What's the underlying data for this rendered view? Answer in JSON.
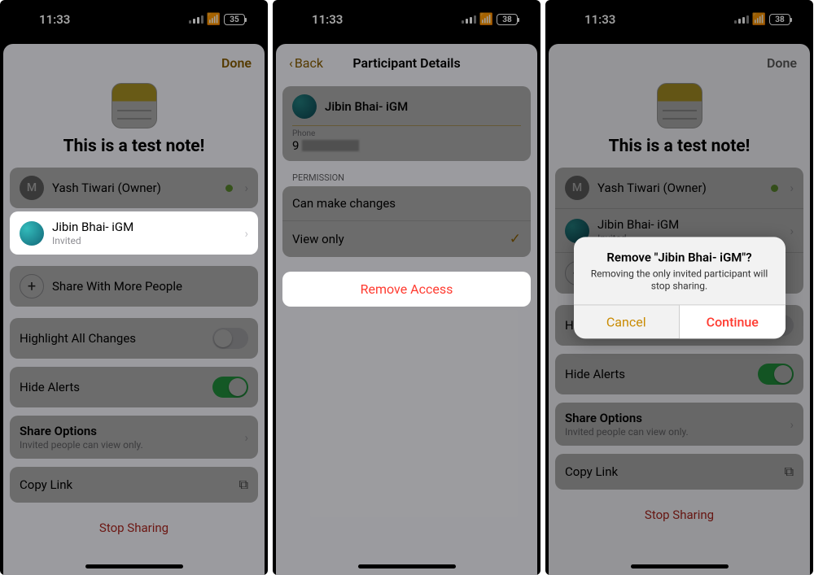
{
  "status": {
    "time": "11:33",
    "battery": "35",
    "battery2": "38"
  },
  "screen1": {
    "done": "Done",
    "note_title": "This is a test note!",
    "owner": {
      "initial": "M",
      "name": "Yash Tiwari (Owner)"
    },
    "invitee": {
      "name": "Jibin Bhai- iGM",
      "status": "Invited"
    },
    "share_more": "Share With More People",
    "highlight_all": "Highlight All Changes",
    "hide_alerts": "Hide Alerts",
    "share_options": "Share Options",
    "share_options_sub": "Invited people can view only.",
    "copy_link": "Copy Link",
    "stop_sharing": "Stop Sharing"
  },
  "screen2": {
    "back": "Back",
    "title": "Participant Details",
    "name": "Jibin Bhai- iGM",
    "phone_label": "Phone",
    "phone_prefix": "9",
    "permission": "PERMISSION",
    "can_make_changes": "Can make changes",
    "view_only": "View only",
    "remove_access": "Remove Access"
  },
  "screen3": {
    "alert_title": "Remove \"Jibin Bhai- iGM\"?",
    "alert_msg": "Removing the only invited participant will stop sharing.",
    "cancel": "Cancel",
    "continue": "Continue"
  }
}
